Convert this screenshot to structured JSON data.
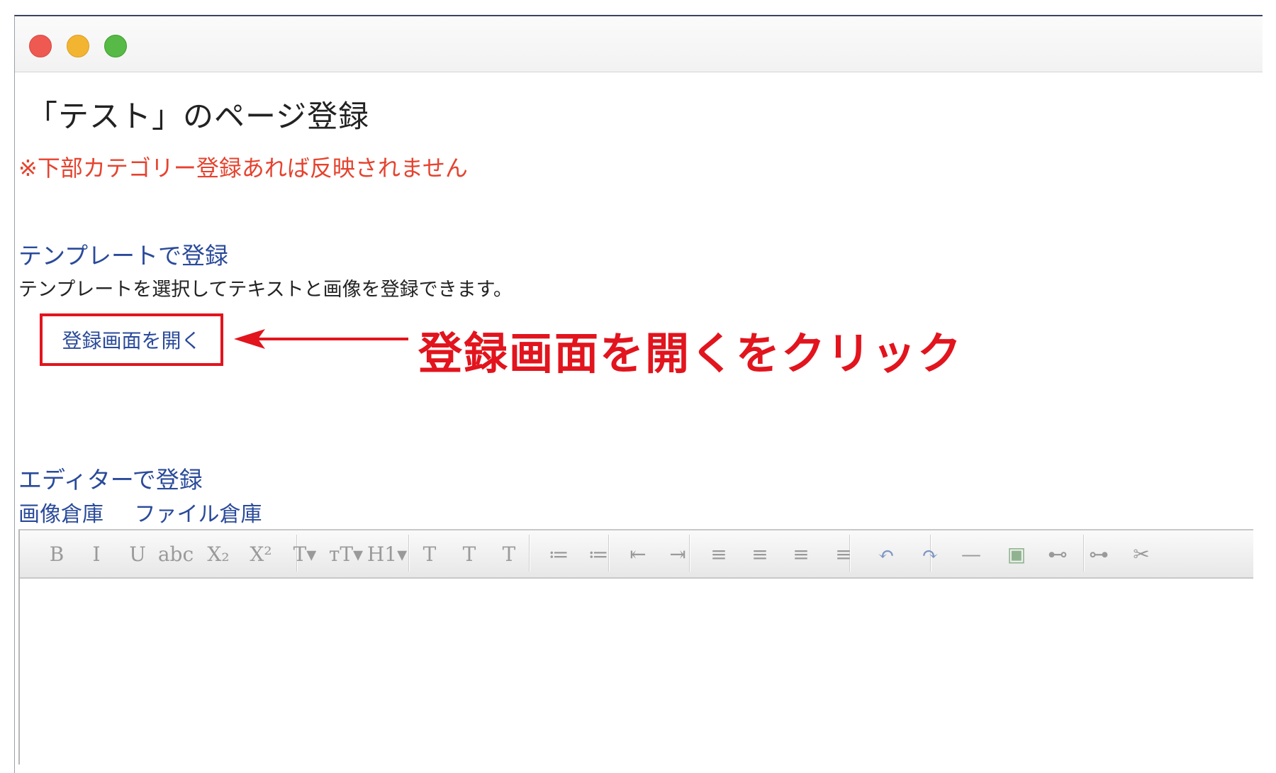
{
  "window": {
    "title": ""
  },
  "page": {
    "title": "「テスト」のページ登録",
    "notice": "※下部カテゴリー登録あれば反映されません"
  },
  "template_section": {
    "heading": "テンプレートで登録",
    "description": "テンプレートを選択してテキストと画像を登録できます。",
    "open_button": "登録画面を開く"
  },
  "annotation": {
    "callout": "登録画面を開くをクリック",
    "color": "#e2141d"
  },
  "editor_section": {
    "heading": "エディターで登録",
    "links": [
      "画像倉庫",
      "ファイル倉庫"
    ]
  },
  "toolbar": {
    "buttons": [
      {
        "icon": "bold-icon",
        "glyph": "B"
      },
      {
        "icon": "italic-icon",
        "glyph": "I"
      },
      {
        "icon": "underline-icon",
        "glyph": "U"
      },
      {
        "icon": "strikethrough-icon",
        "glyph": "abc"
      },
      {
        "icon": "subscript-icon",
        "glyph": "X₂"
      },
      {
        "icon": "superscript-icon",
        "glyph": "X²"
      },
      {
        "icon": "font-size-icon",
        "glyph": "T▾"
      },
      {
        "icon": "font-family-icon",
        "glyph": "тT▾"
      },
      {
        "icon": "heading-icon",
        "glyph": "H1▾"
      },
      {
        "icon": "text-color-icon",
        "glyph": "T"
      },
      {
        "icon": "highlight-icon",
        "glyph": "T"
      },
      {
        "icon": "remove-format-icon",
        "glyph": "T"
      },
      {
        "icon": "bullet-list-icon",
        "glyph": "≔"
      },
      {
        "icon": "numbered-list-icon",
        "glyph": "≔"
      },
      {
        "icon": "outdent-icon",
        "glyph": "⇤"
      },
      {
        "icon": "indent-icon",
        "glyph": "⇥"
      },
      {
        "icon": "align-left-icon",
        "glyph": "≡"
      },
      {
        "icon": "align-center-icon",
        "glyph": "≡"
      },
      {
        "icon": "align-right-icon",
        "glyph": "≡"
      },
      {
        "icon": "justify-icon",
        "glyph": "≡"
      },
      {
        "icon": "undo-icon",
        "glyph": "↶"
      },
      {
        "icon": "redo-icon",
        "glyph": "↷"
      },
      {
        "icon": "horizontal-rule-icon",
        "glyph": "—"
      },
      {
        "icon": "insert-image-icon",
        "glyph": "▣"
      },
      {
        "icon": "link-icon",
        "glyph": "⊷"
      },
      {
        "icon": "unlink-icon",
        "glyph": "⊶"
      },
      {
        "icon": "cut-icon",
        "glyph": "✂"
      }
    ]
  }
}
